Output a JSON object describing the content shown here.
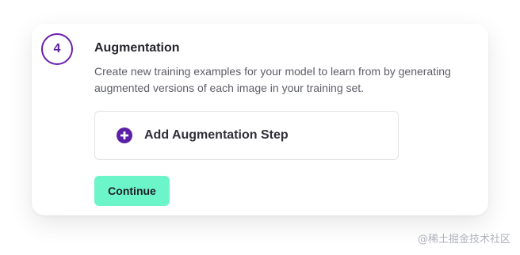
{
  "step": {
    "number": "4",
    "title": "Augmentation",
    "description": "Create new training examples for your model to learn from by generating augmented versions of each image in your training set."
  },
  "add_step": {
    "label": "Add Augmentation Step",
    "icon": "plus-circle-icon"
  },
  "actions": {
    "continue_label": "Continue"
  },
  "colors": {
    "accent": "#5b20a5",
    "continue_bg": "#6cf5c9"
  },
  "watermark": {
    "text": "@稀土掘金技术社区"
  }
}
